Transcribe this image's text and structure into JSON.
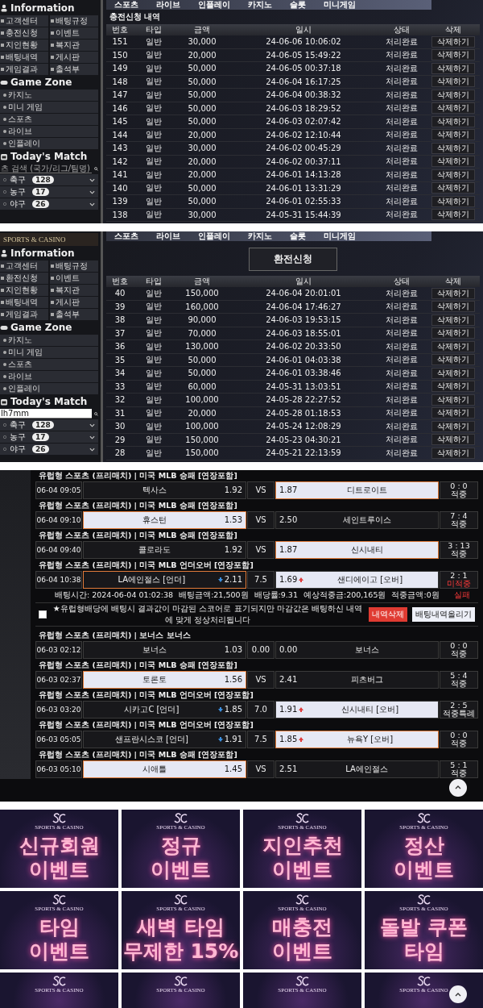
{
  "deposit_history": {
    "nav": [
      "스포츠",
      "라이브",
      "인플레이",
      "카지노",
      "슬롯",
      "미니게임"
    ],
    "sidebar": {
      "sections": [
        {
          "kind": "grid",
          "heading": "Information",
          "items": [
            "고객센터",
            "배팅규정",
            "충전신청",
            "이벤트",
            "지인현황",
            "복지관",
            "배팅내역",
            "게시판",
            "게임결과",
            "출석부"
          ]
        },
        {
          "kind": "list",
          "heading": "Game Zone",
          "items": [
            "카지노",
            "미니 게임",
            "스포츠",
            "라이브",
            "인플레이"
          ]
        },
        {
          "kind": "matches",
          "heading": "Today's Match",
          "search": {
            "placeholder": "츠 검색 (국가/리그/팀명)"
          },
          "sports": [
            {
              "name": "축구",
              "count": "128"
            },
            {
              "name": "농구",
              "count": "17"
            },
            {
              "name": "야구",
              "count": "26"
            }
          ]
        }
      ]
    },
    "title": {
      "kind": "plain",
      "text": "충전신청 내역"
    },
    "columns": [
      "번호",
      "타입",
      "금액",
      "일시",
      "상태",
      "삭제"
    ],
    "rows": [
      {
        "no": "151",
        "type": "일반",
        "amount": "30,000",
        "date": "24-06-06 10:06:02",
        "status": "처리완료",
        "action": "삭제하기"
      },
      {
        "no": "150",
        "type": "일반",
        "amount": "20,000",
        "date": "24-06-05 15:49:22",
        "status": "처리완료",
        "action": "삭제하기"
      },
      {
        "no": "149",
        "type": "일반",
        "amount": "50,000",
        "date": "24-06-05 00:37:18",
        "status": "처리완료",
        "action": "삭제하기"
      },
      {
        "no": "148",
        "type": "일반",
        "amount": "50,000",
        "date": "24-06-04 16:17:25",
        "status": "처리완료",
        "action": "삭제하기"
      },
      {
        "no": "147",
        "type": "일반",
        "amount": "50,000",
        "date": "24-06-04 00:38:32",
        "status": "처리완료",
        "action": "삭제하기"
      },
      {
        "no": "146",
        "type": "일반",
        "amount": "50,000",
        "date": "24-06-03 18:29:52",
        "status": "처리완료",
        "action": "삭제하기"
      },
      {
        "no": "145",
        "type": "일반",
        "amount": "50,000",
        "date": "24-06-03 02:07:42",
        "status": "처리완료",
        "action": "삭제하기"
      },
      {
        "no": "144",
        "type": "일반",
        "amount": "20,000",
        "date": "24-06-02 12:10:44",
        "status": "처리완료",
        "action": "삭제하기"
      },
      {
        "no": "143",
        "type": "일반",
        "amount": "30,000",
        "date": "24-06-02 00:45:29",
        "status": "처리완료",
        "action": "삭제하기"
      },
      {
        "no": "142",
        "type": "일반",
        "amount": "20,000",
        "date": "24-06-02 00:37:11",
        "status": "처리완료",
        "action": "삭제하기"
      },
      {
        "no": "141",
        "type": "일반",
        "amount": "20,000",
        "date": "24-06-01 14:13:28",
        "status": "처리완료",
        "action": "삭제하기"
      },
      {
        "no": "140",
        "type": "일반",
        "amount": "50,000",
        "date": "24-06-01 13:31:29",
        "status": "처리완료",
        "action": "삭제하기"
      },
      {
        "no": "139",
        "type": "일반",
        "amount": "50,000",
        "date": "24-06-01 02:55:33",
        "status": "처리완료",
        "action": "삭제하기"
      },
      {
        "no": "138",
        "type": "일반",
        "amount": "30,000",
        "date": "24-05-31 15:44:39",
        "status": "처리완료",
        "action": "삭제하기"
      }
    ]
  },
  "withdrawal_request": {
    "logo": "SPORTS & CASINO",
    "nav": [
      "스포츠",
      "라이브",
      "인플레이",
      "카지노",
      "슬롯",
      "미니게임"
    ],
    "sidebar": {
      "sections": [
        {
          "kind": "grid",
          "heading": "Information",
          "items": [
            "고객센터",
            "배팅규정",
            "환전신청",
            "이벤트",
            "지인현황",
            "복지관",
            "배팅내역",
            "게시판",
            "게임결과",
            "출석부"
          ]
        },
        {
          "kind": "list",
          "heading": "Game Zone",
          "items": [
            "카지노",
            "미니 게임",
            "스포츠",
            "라이브",
            "인플레이"
          ]
        },
        {
          "kind": "matches",
          "heading": "Today's Match",
          "search": {
            "value": "lh7mm"
          },
          "sports": [
            {
              "name": "축구",
              "count": "128"
            },
            {
              "name": "농구",
              "count": "17"
            },
            {
              "name": "야구",
              "count": "26"
            }
          ]
        }
      ]
    },
    "title": {
      "kind": "boxed",
      "text": "환전신청"
    },
    "columns": [
      "번호",
      "타입",
      "금액",
      "일시",
      "상태",
      "삭제"
    ],
    "rows": [
      {
        "no": "40",
        "type": "일반",
        "amount": "150,000",
        "date": "24-06-04 20:01:01",
        "status": "처리완료",
        "action": "삭제하기"
      },
      {
        "no": "39",
        "type": "일반",
        "amount": "160,000",
        "date": "24-06-04 17:46:27",
        "status": "처리완료",
        "action": "삭제하기"
      },
      {
        "no": "38",
        "type": "일반",
        "amount": "90,000",
        "date": "24-06-03 19:53:15",
        "status": "처리완료",
        "action": "삭제하기"
      },
      {
        "no": "37",
        "type": "일반",
        "amount": "70,000",
        "date": "24-06-03 18:55:01",
        "status": "처리완료",
        "action": "삭제하기"
      },
      {
        "no": "36",
        "type": "일반",
        "amount": "130,000",
        "date": "24-06-02 20:33:50",
        "status": "처리완료",
        "action": "삭제하기"
      },
      {
        "no": "35",
        "type": "일반",
        "amount": "50,000",
        "date": "24-06-01 04:03:38",
        "status": "처리완료",
        "action": "삭제하기"
      },
      {
        "no": "34",
        "type": "일반",
        "amount": "50,000",
        "date": "24-06-01 03:38:46",
        "status": "처리완료",
        "action": "삭제하기"
      },
      {
        "no": "33",
        "type": "일반",
        "amount": "60,000",
        "date": "24-05-31 13:03:51",
        "status": "처리완료",
        "action": "삭제하기"
      },
      {
        "no": "32",
        "type": "일반",
        "amount": "100,000",
        "date": "24-05-28 22:27:52",
        "status": "처리완료",
        "action": "삭제하기"
      },
      {
        "no": "31",
        "type": "일반",
        "amount": "20,000",
        "date": "24-05-28 01:18:53",
        "status": "처리완료",
        "action": "삭제하기"
      },
      {
        "no": "30",
        "type": "일반",
        "amount": "100,000",
        "date": "24-05-24 12:08:29",
        "status": "처리완료",
        "action": "삭제하기"
      },
      {
        "no": "29",
        "type": "일반",
        "amount": "150,000",
        "date": "24-05-23 04:30:21",
        "status": "처리완료",
        "action": "삭제하기"
      },
      {
        "no": "28",
        "type": "일반",
        "amount": "150,000",
        "date": "24-05-21 22:13:59",
        "status": "처리완료",
        "action": "삭제하기"
      }
    ]
  },
  "bet_history": {
    "bets": [
      {
        "matches": [
          {
            "header": "유럽형 스포츠 (프리매치) | 미국 MLB  승패 [연장포함]",
            "time": "06-04 09:05",
            "home": {
              "team": "텍사스",
              "odds": "1.92",
              "winner": false,
              "picked": false
            },
            "middle": "VS",
            "away": {
              "team": "디트로이트",
              "odds": "1.87",
              "winner": true,
              "picked": true
            },
            "score": "0 : 0",
            "result": "적중",
            "failed": false
          },
          {
            "header": "유럽형 스포츠 (프리매치) | 미국 MLB  승패 [연장포함]",
            "time": "06-04 09:10",
            "home": {
              "team": "휴스턴",
              "odds": "1.53",
              "winner": true,
              "picked": true
            },
            "middle": "VS",
            "away": {
              "team": "세인트루이스",
              "odds": "2.50",
              "winner": false,
              "picked": false
            },
            "score": "7 : 4",
            "result": "적중",
            "failed": false
          },
          {
            "header": "유럽형 스포츠 (프리매치) | 미국 MLB  승패 [연장포함]",
            "time": "06-04 09:40",
            "home": {
              "team": "콜로라도",
              "odds": "1.92",
              "winner": false,
              "picked": false
            },
            "middle": "VS",
            "away": {
              "team": "신시내티",
              "odds": "1.87",
              "winner": true,
              "picked": true
            },
            "score": "3 : 13",
            "result": "적중",
            "failed": false
          },
          {
            "header": "유럽형 스포츠 (프리매치) | 미국 MLB  언더오버 [연장포함]",
            "time": "06-04 10:38",
            "home": {
              "team": "LA에인절스 [언더]",
              "odds": "2.11",
              "falling": true,
              "winner": false,
              "picked": true
            },
            "middle": "7.5",
            "away": {
              "team": "샌디에이고 [오버]",
              "odds": "1.69",
              "rising": true,
              "winner": true,
              "picked": false
            },
            "score": "2 : 1",
            "result": "미적중",
            "failed": true
          }
        ],
        "summary": {
          "items": [
            "배팅시간: 2024-06-04 01:02:38",
            "배팅금액:21,500원",
            "배당률:9.31",
            "예상적중금:200,165원",
            "적중금액:0원"
          ],
          "status": "실패",
          "failed": true
        },
        "notice": {
          "checked": false,
          "text": "★유럽형배당에 배팅시 결과값이 마감된 스코어로 표기되지만 마감값은 배팅하신 내역에 맞게 정상처리됩니다",
          "buttons": [
            {
              "label": "내역삭제",
              "kind": "danger"
            },
            {
              "label": "배팅내역올리기",
              "kind": "light"
            }
          ]
        }
      },
      {
        "matches": [
          {
            "header": "유럽형 스포츠 (프리매치) | 보너스  보너스",
            "time": "06-03 02:12",
            "home": {
              "team": "보너스",
              "odds": "1.03",
              "winner": false,
              "picked": false
            },
            "middle": "0.00",
            "away": {
              "team": "보너스",
              "odds": "0.00",
              "winner": false,
              "picked": false
            },
            "score": "0 : 0",
            "result": "적중",
            "failed": false
          },
          {
            "header": "유럽형 스포츠 (프리매치) | 미국 MLB  승패 [연장포함]",
            "time": "06-03 02:37",
            "home": {
              "team": "토론토",
              "odds": "1.56",
              "winner": true,
              "picked": true
            },
            "middle": "VS",
            "away": {
              "team": "피츠버그",
              "odds": "2.41",
              "winner": false,
              "picked": false
            },
            "score": "5 : 4",
            "result": "적중",
            "failed": false
          },
          {
            "header": "유럽형 스포츠 (프리매치) | 미국 MLB  언더오버 [연장포함]",
            "time": "06-03 03:20",
            "home": {
              "team": "시카고C [언더]",
              "odds": "1.85",
              "falling": true,
              "winner": false,
              "picked": false
            },
            "middle": "7.0",
            "away": {
              "team": "신시내티 [오버]",
              "odds": "1.91",
              "rising": true,
              "winner": true,
              "picked": false
            },
            "score": "2 : 5",
            "result": "적중특례",
            "failed": false
          },
          {
            "header": "유럽형 스포츠 (프리매치) | 미국 MLB  언더오버 [연장포함]",
            "time": "06-03 05:05",
            "home": {
              "team": "샌프란시스코 [언더]",
              "odds": "1.91",
              "falling": true,
              "winner": false,
              "picked": false
            },
            "middle": "7.5",
            "away": {
              "team": "뉴욕Y [오버]",
              "odds": "1.85",
              "rising": true,
              "winner": true,
              "picked": true
            },
            "score": "0 : 0",
            "result": "적중",
            "failed": false
          },
          {
            "header": "유럽형 스포츠 (프리매치) | 미국 MLB  승패 [연장포함]",
            "time": "06-03 05:10",
            "home": {
              "team": "시애틀",
              "odds": "1.45",
              "winner": true,
              "picked": true
            },
            "middle": "VS",
            "away": {
              "team": "LA에인절스",
              "odds": "2.51",
              "winner": false,
              "picked": false
            },
            "score": "5 : 1",
            "result": "적중",
            "failed": false
          }
        ]
      }
    ]
  },
  "events": {
    "banners": [
      {
        "logo": "SPORTS & CASINO",
        "lines": [
          "신규회원",
          "이벤트"
        ]
      },
      {
        "logo": "SPORTS & CASINO",
        "lines": [
          "정규",
          "이벤트"
        ]
      },
      {
        "logo": "SPORTS & CASINO",
        "lines": [
          "지인추천",
          "이벤트"
        ]
      },
      {
        "logo": "SPORTS & CASINO",
        "lines": [
          "정산",
          "이벤트"
        ]
      },
      {
        "logo": "SPORTS & CASINO",
        "lines": [
          "타임",
          "이벤트"
        ]
      },
      {
        "logo": "SPORTS & CASINO",
        "lines": [
          "새벽 타임",
          "무제한 15%"
        ]
      },
      {
        "logo": "SPORTS & CASINO",
        "lines": [
          "매충전",
          "이벤트"
        ]
      },
      {
        "logo": "SPORTS & CASINO",
        "lines": [
          "돌발 쿠폰",
          "타임"
        ]
      },
      {
        "logo": "SPORTS & CASINO"
      },
      {
        "logo": "SPORTS & CASINO"
      },
      {
        "logo": "SPORTS & CASINO"
      },
      {
        "logo": "SPORTS & CASINO"
      }
    ]
  }
}
